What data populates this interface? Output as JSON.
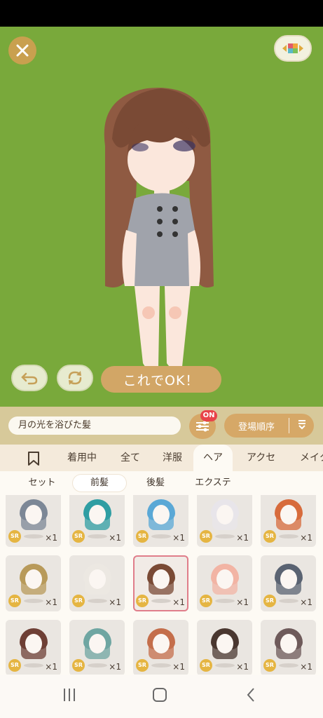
{
  "stage": {
    "close_icon": "close-icon",
    "view_icon": "color-palette-icon",
    "undo_icon": "undo-icon",
    "rotate_icon": "rotate-icon",
    "ok_label": "これでOK！",
    "bg_color": "#79a93b"
  },
  "toolbar": {
    "item_name": "月の光を浴びた髪",
    "filter_badge": "ON",
    "sort_label": "登場順序"
  },
  "category_tabs": [
    "着用中",
    "全て",
    "洋服",
    "ヘア",
    "アクセ",
    "メイク"
  ],
  "active_category": "ヘア",
  "sub_tabs": [
    "セット",
    "前髪",
    "後髪",
    "エクステ"
  ],
  "grid": {
    "badge": "SR",
    "items": [
      {
        "count": "×1",
        "hair_color": "#7c8796"
      },
      {
        "count": "×1",
        "hair_color": "#2f9ea3"
      },
      {
        "count": "×1",
        "hair_color": "#5aa8d6"
      },
      {
        "count": "×1",
        "hair_color": "#e8e5ea"
      },
      {
        "count": "×1",
        "hair_color": "#d76b3c"
      },
      {
        "count": "×1",
        "hair_color": "#b89a5a"
      },
      {
        "count": "×1",
        "hair_color": "#ece8e2"
      },
      {
        "count": "×1",
        "hair_color": "#7a4a35",
        "selected": true
      },
      {
        "count": "×1",
        "hair_color": "#f2b4a4"
      },
      {
        "count": "×1",
        "hair_color": "#5a6372"
      },
      {
        "count": "×1",
        "hair_color": "#6e3f35"
      },
      {
        "count": "×1",
        "hair_color": "#6fa6a2"
      },
      {
        "count": "×1",
        "hair_color": "#c46e4b"
      },
      {
        "count": "×1",
        "hair_color": "#4a3730"
      },
      {
        "count": "×1",
        "hair_color": "#6e5a5a"
      }
    ]
  },
  "nav": {
    "recents_icon": "recents-icon",
    "home_icon": "home-icon",
    "back_icon": "back-icon"
  }
}
